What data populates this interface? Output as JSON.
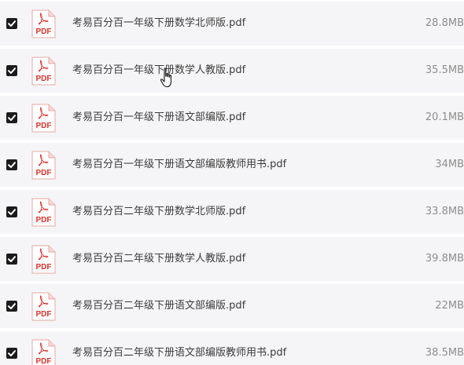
{
  "icons": {
    "file_type_label": "PDF",
    "file_icon_color": "#e0322b",
    "checkbox_color": "#1c1c1c"
  },
  "files": [
    {
      "name": "考易百分百一年级下册数学北师版.pdf",
      "size": "28.8MB",
      "checked": true
    },
    {
      "name": "考易百分百一年级下册数学人教版.pdf",
      "size": "35.5MB",
      "checked": true
    },
    {
      "name": "考易百分百一年级下册语文部编版.pdf",
      "size": "20.1MB",
      "checked": true
    },
    {
      "name": "考易百分百一年级下册语文部编版教师用书.pdf",
      "size": "34MB",
      "checked": true
    },
    {
      "name": "考易百分百二年级下册数学北师版.pdf",
      "size": "33.8MB",
      "checked": true
    },
    {
      "name": "考易百分百二年级下册数学人教版.pdf",
      "size": "39.8MB",
      "checked": true
    },
    {
      "name": "考易百分百二年级下册语文部编版.pdf",
      "size": "22MB",
      "checked": true
    },
    {
      "name": "考易百分百二年级下册语文部编版教师用书.pdf",
      "size": "38.5MB",
      "checked": true
    }
  ]
}
